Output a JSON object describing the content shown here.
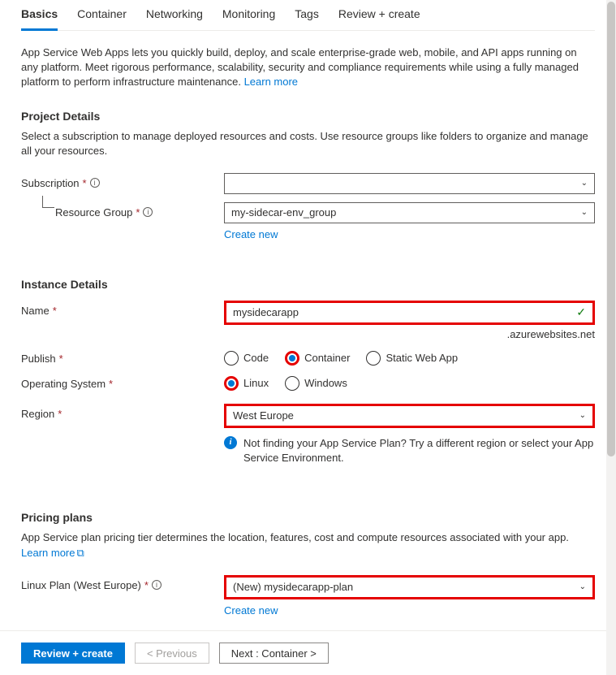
{
  "tabs": {
    "items": [
      {
        "label": "Basics",
        "active": true
      },
      {
        "label": "Container",
        "active": false
      },
      {
        "label": "Networking",
        "active": false
      },
      {
        "label": "Monitoring",
        "active": false
      },
      {
        "label": "Tags",
        "active": false
      },
      {
        "label": "Review + create",
        "active": false
      }
    ]
  },
  "intro": {
    "text": "App Service Web Apps lets you quickly build, deploy, and scale enterprise-grade web, mobile, and API apps running on any platform. Meet rigorous performance, scalability, security and compliance requirements while using a fully managed platform to perform infrastructure maintenance.  ",
    "learn_more": "Learn more"
  },
  "project_details": {
    "heading": "Project Details",
    "desc": "Select a subscription to manage deployed resources and costs. Use resource groups like folders to organize and manage all your resources.",
    "subscription_label": "Subscription",
    "subscription_value": "",
    "rg_label": "Resource Group",
    "rg_value": "my-sidecar-env_group",
    "create_new": "Create new"
  },
  "instance_details": {
    "heading": "Instance Details",
    "name_label": "Name",
    "name_value": "mysidecarapp",
    "name_suffix": ".azurewebsites.net",
    "publish_label": "Publish",
    "publish_options": [
      {
        "label": "Code",
        "selected": false
      },
      {
        "label": "Container",
        "selected": true
      },
      {
        "label": "Static Web App",
        "selected": false
      }
    ],
    "os_label": "Operating System",
    "os_options": [
      {
        "label": "Linux",
        "selected": true
      },
      {
        "label": "Windows",
        "selected": false
      }
    ],
    "region_label": "Region",
    "region_value": "West Europe",
    "region_info": "Not finding your App Service Plan? Try a different region or select your App Service Environment."
  },
  "pricing": {
    "heading": "Pricing plans",
    "desc": "App Service plan pricing tier determines the location, features, cost and compute resources associated with your app. ",
    "learn_more": "Learn more",
    "plan_label": "Linux Plan (West Europe)",
    "plan_value": "(New) mysidecarapp-plan",
    "create_new": "Create new"
  },
  "footer": {
    "review": "Review + create",
    "previous": "< Previous",
    "next": "Next : Container >"
  }
}
